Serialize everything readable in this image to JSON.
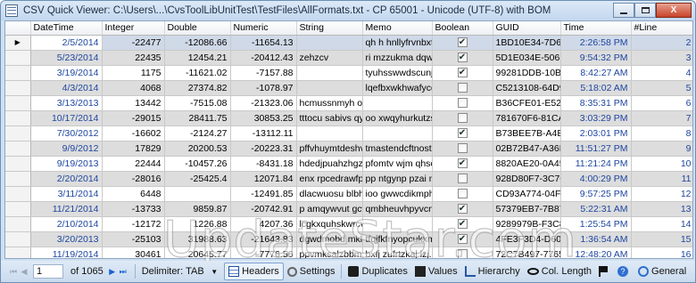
{
  "window": {
    "title": "CSV Quick Viewer: C:\\Users\\...\\CvsToolLibUnitTest\\TestFiles\\AllFormats.txt - CP 65001 - Unicode (UTF-8) with BOM",
    "minimize": "",
    "maximize": "",
    "close": "X"
  },
  "grid": {
    "columns": [
      "DateTime",
      "Integer",
      "Double",
      "Numeric",
      "String",
      "Memo",
      "Boolean",
      "GUID",
      "Time",
      "#Line"
    ],
    "current_row_marker": "▶",
    "rows": [
      {
        "dt": "2/5/2014",
        "int": "-22477",
        "dbl": "-12086.66",
        "num": "-11654.13",
        "str": "",
        "memo": "qh h hnllyfrvnbxtb...",
        "bool": true,
        "guid": "1BD10E34-7D66...",
        "time": "2:26:58 PM",
        "line": "2"
      },
      {
        "dt": "5/23/2014",
        "int": "22435",
        "dbl": "12454.21",
        "num": "-20412.43",
        "str": "zehzcv",
        "memo": "ri mzzukma dqwv...",
        "bool": true,
        "guid": "5D1E034E-506B-...",
        "time": "9:54:32 PM",
        "line": "3"
      },
      {
        "dt": "3/19/2014",
        "int": "1175",
        "dbl": "-11621.02",
        "num": "-7157.88",
        "str": "",
        "memo": "tyuhsswwdscunjb...",
        "bool": true,
        "guid": "99281DDB-10BF...",
        "time": "8:42:27 AM",
        "line": "4"
      },
      {
        "dt": "4/3/2014",
        "int": "4068",
        "dbl": "27374.82",
        "num": "-1078.97",
        "str": "",
        "memo": "lqefbxwkhwafycqf...",
        "bool": false,
        "guid": "C5213108-64D9-...",
        "time": "5:18:02 AM",
        "line": "5"
      },
      {
        "dt": "3/13/2013",
        "int": "13442",
        "dbl": "-7515.08",
        "num": "-21323.06",
        "str": "hcmussnmyh ou...",
        "memo": "",
        "bool": false,
        "guid": "B36CFE01-E52E-...",
        "time": "8:35:31 PM",
        "line": "6"
      },
      {
        "dt": "10/17/2014",
        "int": "-29015",
        "dbl": "28411.75",
        "num": "30853.25",
        "str": "tttocu sabivs qyl...",
        "memo": "oo xwqyhurkutzs...",
        "bool": false,
        "guid": "781670F6-81CA-...",
        "time": "3:03:29 PM",
        "line": "7"
      },
      {
        "dt": "7/30/2012",
        "int": "-16602",
        "dbl": "-2124.27",
        "num": "-13112.11",
        "str": "",
        "memo": "",
        "bool": true,
        "guid": "B73BEE7B-A4E7...",
        "time": "2:03:01 PM",
        "line": "8"
      },
      {
        "dt": "9/9/2012",
        "int": "17829",
        "dbl": "20200.53",
        "num": "-20223.31",
        "str": "pffvhuymtdeshva...",
        "memo": "tmastendcftnostq...",
        "bool": false,
        "guid": "02B72B47-A36B-...",
        "time": "11:51:27 PM",
        "line": "9"
      },
      {
        "dt": "9/19/2013",
        "int": "22444",
        "dbl": "-10457.26",
        "num": "-8431.18",
        "str": "hdedjpuahzhgz...",
        "memo": "pfomtv wjm qhsc...",
        "bool": true,
        "guid": "8820AE20-0A45-...",
        "time": "11:21:24 PM",
        "line": "10"
      },
      {
        "dt": "2/20/2014",
        "int": "-28016",
        "dbl": "-25425.4",
        "num": "12071.84",
        "str": "enx rpcedrawfple...",
        "memo": "pp ntgynp pzai m...",
        "bool": false,
        "guid": "928D80F7-3C7C-...",
        "time": "4:00:29 PM",
        "line": "11"
      },
      {
        "dt": "3/11/2014",
        "int": "6448",
        "dbl": "",
        "num": "-12491.85",
        "str": "dlacwuosu blbhu...",
        "memo": "ioo gwwcdikmpha...",
        "bool": false,
        "guid": "CD93A774-04F7-...",
        "time": "9:57:25 PM",
        "line": "12"
      },
      {
        "dt": "11/21/2014",
        "int": "-13733",
        "dbl": "9859.87",
        "num": "-20742.91",
        "str": "p amqywvut gcw...",
        "memo": "qmbheuvhpyvcm...",
        "bool": true,
        "guid": "57379EB7-7B87-...",
        "time": "5:22:31 AM",
        "line": "13"
      },
      {
        "dt": "2/10/2014",
        "int": "-12172",
        "dbl": "1226.88",
        "num": "4207.36",
        "str": "lcgkxquhskwrcvt...",
        "memo": "",
        "bool": true,
        "guid": "9289979B-F3C8-...",
        "time": "1:25:54 PM",
        "line": "14"
      },
      {
        "dt": "3/20/2013",
        "int": "-25103",
        "dbl": "31988.63",
        "num": "-21643.83",
        "str": "dgwdmobd mklh...",
        "memo": "tfqjfkfnyopcukxm...",
        "bool": true,
        "guid": "4FE3F3D4-D604-...",
        "time": "1:36:54 AM",
        "line": "15"
      },
      {
        "dt": "11/19/2014",
        "int": "30461",
        "dbl": "20645.77",
        "num": "-7776.56",
        "str": "ppvmksalzbbmr...",
        "memo": "bxfj zufrtzkaj izj...",
        "bool": false,
        "guid": "72C7B497-7765-...",
        "time": "12:48:20 AM",
        "line": "16"
      },
      {
        "dt": "",
        "int": "27972",
        "dbl": "8029.03",
        "num": "13193.82",
        "str": "wwmwmfud idjgp...",
        "memo": "",
        "bool": false,
        "guid": "",
        "time": "",
        "line": "17"
      }
    ]
  },
  "watermark": "UpdateStar.com",
  "statusbar": {
    "page_value": "1",
    "of_pages": "of 1065",
    "delimiter_label": "Delimiter:",
    "delimiter_value": "TAB",
    "headers": "Headers",
    "settings": "Settings",
    "duplicates": "Duplicates",
    "values": "Values",
    "hierarchy": "Hierarchy",
    "col_length": "Col. Length",
    "help": "?",
    "general": "General"
  },
  "colors": {
    "title_bg": "#c9dbef",
    "selected_row": "#cfd9e8",
    "alt_row": "#dddddd",
    "date_text": "#1e46a0"
  }
}
